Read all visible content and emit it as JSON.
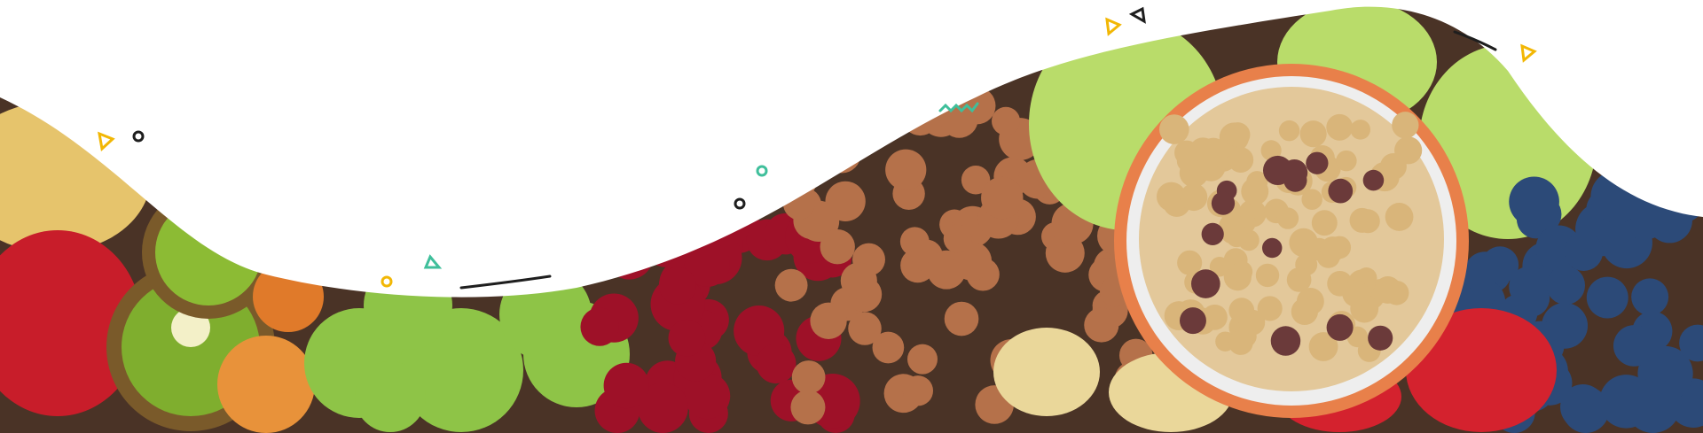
{
  "colors": {
    "background": "#ffffff",
    "accent_yellow": "#f2b705",
    "accent_teal": "#3fbf9b",
    "accent_dark": "#1e1e1e",
    "bowl_rim": "#e8804a",
    "pasta": "#b5714a",
    "cranberry": "#9e1128",
    "sprout": "#8ec447",
    "blueberry": "#2c4a78",
    "strawberry": "#d4222e",
    "kiwi": "#7fae2e",
    "cabbage": "#b9dc6a"
  },
  "decorations": [
    "triangle-icon",
    "circle-icon",
    "zigzag-icon",
    "line-icon"
  ]
}
